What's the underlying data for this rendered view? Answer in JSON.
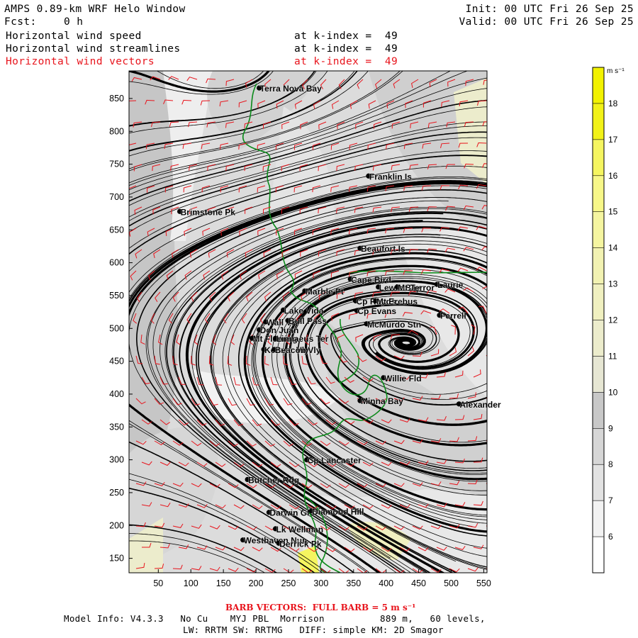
{
  "header": {
    "title": "AMPS 0.89-km WRF Helo Window",
    "forecast_label": "Fcst:",
    "forecast_value": "0 h",
    "init": "Init: 00 UTC Fri 26 Sep 25",
    "valid": "Valid: 00 UTC Fri 26 Sep 25",
    "fields": [
      {
        "name": "Horizontal wind speed",
        "level": "at k-index =  49",
        "color": "#000000"
      },
      {
        "name": "Horizontal wind streamlines",
        "level": "at k-index =  49",
        "color": "#000000"
      },
      {
        "name": "Horizontal wind vectors",
        "level": "at k-index =  49",
        "color": "#e8141c"
      }
    ]
  },
  "map": {
    "x_ticks": [
      50,
      100,
      150,
      200,
      250,
      300,
      350,
      400,
      450,
      500,
      550
    ],
    "y_ticks": [
      150,
      200,
      250,
      300,
      350,
      400,
      450,
      500,
      550,
      600,
      650,
      700,
      750,
      800,
      850
    ],
    "x_range": [
      5,
      555
    ],
    "y_range": [
      128,
      892
    ],
    "places": [
      {
        "name": "Terra Nova Bay",
        "x": 205,
        "y": 866
      },
      {
        "name": "Franklin Is",
        "x": 373,
        "y": 732
      },
      {
        "name": "Brimstone Pk",
        "x": 83,
        "y": 678
      },
      {
        "name": "Beaufort Is",
        "x": 360,
        "y": 622
      },
      {
        "name": "Cape Bird",
        "x": 345,
        "y": 575
      },
      {
        "name": "Lewis Bay",
        "x": 388,
        "y": 563
      },
      {
        "name": "Mt Terror",
        "x": 417,
        "y": 563
      },
      {
        "name": "Laurie",
        "x": 478,
        "y": 567
      },
      {
        "name": "Marble Pt",
        "x": 275,
        "y": 557
      },
      {
        "name": "Cp Royds",
        "x": 353,
        "y": 542
      },
      {
        "name": "Mt Erebus",
        "x": 384,
        "y": 542
      },
      {
        "name": "Lake Vida",
        "x": 242,
        "y": 528
      },
      {
        "name": "Cp Evans",
        "x": 355,
        "y": 527
      },
      {
        "name": "Ferrell",
        "x": 482,
        "y": 520
      },
      {
        "name": "Wall Vly",
        "x": 215,
        "y": 510
      },
      {
        "name": "Bull Pass",
        "x": 249,
        "y": 512
      },
      {
        "name": "McMurdo Stn",
        "x": 370,
        "y": 507
      },
      {
        "name": "Don Juan",
        "x": 205,
        "y": 498
      },
      {
        "name": "Mt Fleming",
        "x": 194,
        "y": 485
      },
      {
        "name": "Linnaeus Ter",
        "x": 230,
        "y": 485
      },
      {
        "name": "Kennar Vly",
        "x": 212,
        "y": 468
      },
      {
        "name": "Beacon Vly",
        "x": 228,
        "y": 468
      },
      {
        "name": "Willie Fld",
        "x": 396,
        "y": 425
      },
      {
        "name": "Minna Bay",
        "x": 360,
        "y": 390
      },
      {
        "name": "Alexander",
        "x": 512,
        "y": 385
      },
      {
        "name": "Cp Lancaster",
        "x": 278,
        "y": 300
      },
      {
        "name": "Butcher Rdg",
        "x": 187,
        "y": 270
      },
      {
        "name": "Darwin Gl",
        "x": 220,
        "y": 220
      },
      {
        "name": "Diamond Hill",
        "x": 285,
        "y": 222
      },
      {
        "name": "Lk Wellman",
        "x": 230,
        "y": 195
      },
      {
        "name": "Westhaven Nun",
        "x": 180,
        "y": 178
      },
      {
        "name": "Derrick Pk",
        "x": 235,
        "y": 173
      }
    ]
  },
  "colorbar": {
    "unit": "m s⁻¹",
    "labels": [
      "6",
      "7",
      "8",
      "9",
      "10",
      "11",
      "12",
      "13",
      "14",
      "15",
      "16",
      "17",
      "18"
    ],
    "colors": [
      "#ffffff",
      "#f2f2f2",
      "#e2e2e2",
      "#d6d6d6",
      "#c8c8c8",
      "#e6e6d3",
      "#ececcc",
      "#f0f0c0",
      "#f2f2b2",
      "#f5f5a0",
      "#f7f788",
      "#f5f560",
      "#f2f218",
      "#f2f200"
    ]
  },
  "footer": {
    "barb_prefix": "BARB VECTORS:",
    "barb_text": "FULL BARB = 5 m s⁻¹",
    "model_line": "Model Info: V4.3.3   No Cu    MYJ PBL  Morrison          889 m,   60 levels,",
    "physics_line": "LW: RRTM SW: RRTMG   DIFF: simple KM: 2D Smagor"
  }
}
